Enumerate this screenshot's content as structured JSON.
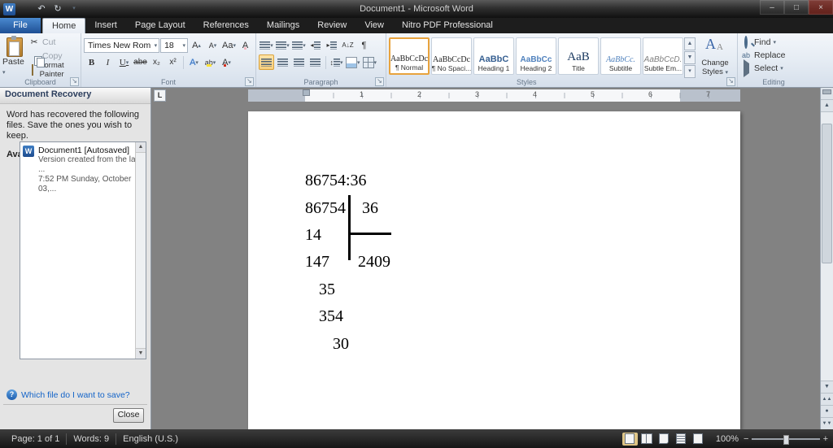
{
  "titlebar": {
    "title": "Document1 - Microsoft Word"
  },
  "window_controls": {
    "minimize": "–",
    "maximize": "□",
    "close": "×"
  },
  "quick_access": {
    "word": "W",
    "undo": "↶",
    "repeat": "↻"
  },
  "icons": {
    "caret": "▾",
    "caret_up": "▴",
    "launcher": "↘",
    "scissors": "✂",
    "pilcrow": "¶",
    "updown": "↕",
    "sort": "A↓Z"
  },
  "tabs": {
    "file": "File",
    "items": [
      "Home",
      "Insert",
      "Page Layout",
      "References",
      "Mailings",
      "Review",
      "View",
      "Nitro PDF Professional"
    ]
  },
  "ribbon": {
    "clipboard": {
      "label": "Clipboard",
      "paste": "Paste",
      "cut": "Cut",
      "copy": "Copy",
      "format_painter": "Format Painter"
    },
    "font": {
      "label": "Font",
      "family": "Times New Rom",
      "size": "18",
      "bold": "B",
      "italic": "I",
      "underline": "U",
      "strike": "abe",
      "sub": "x₂",
      "sup": "x²",
      "grow": "A",
      "shrink": "A",
      "case": "Aa",
      "clear": "A",
      "effects": "A",
      "highlight": "ab",
      "color": "A"
    },
    "paragraph": {
      "label": "Paragraph"
    },
    "styles": {
      "label": "Styles",
      "items": [
        {
          "sample": "AaBbCcDc",
          "name": "¶ Normal"
        },
        {
          "sample": "AaBbCcDc",
          "name": "¶ No Spaci..."
        },
        {
          "sample": "AaBbC",
          "name": "Heading 1"
        },
        {
          "sample": "AaBbCc",
          "name": "Heading 2"
        },
        {
          "sample": "AaB",
          "name": "Title"
        },
        {
          "sample": "AaBbCc.",
          "name": "Subtitle"
        },
        {
          "sample": "AaBbCcD.",
          "name": "Subtle Em..."
        }
      ],
      "change_styles": "Change Styles"
    },
    "editing": {
      "label": "Editing",
      "find": "Find",
      "replace": "Replace",
      "replace_icon": "ab",
      "select": "Select"
    }
  },
  "recovery": {
    "title": "Document Recovery",
    "message": "Word has recovered the following files.  Save the ones you wish to keep.",
    "available": "Available files",
    "file": {
      "icon": "W",
      "name": "Document1  [Autosaved]",
      "line2": "Version created from the last ...",
      "line3": "7:52 PM Sunday, October 03,..."
    },
    "help_icon": "?",
    "help": "Which file do I want to save?",
    "close": "Close"
  },
  "ruler": {
    "tab_selector": "L",
    "numbers": [
      "1",
      "2",
      "3",
      "4",
      "5",
      "6",
      "7"
    ]
  },
  "document": {
    "line1": "86754:36",
    "line2_dividend": "86754",
    "line2_divisor": "36",
    "line3": "14",
    "line4_left": "147",
    "line4_quotient": "2409",
    "line5": "35",
    "line6": "354",
    "line7": "30"
  },
  "scrollbar": {
    "up": "▲",
    "down": "▼",
    "dot": "●",
    "prev": "▲▲",
    "next": "▼▼"
  },
  "status": {
    "page": "Page: 1 of 1",
    "words": "Words: 9",
    "language": "English (U.S.)",
    "zoom": "100%",
    "zoom_out": "−",
    "zoom_in": "+"
  }
}
